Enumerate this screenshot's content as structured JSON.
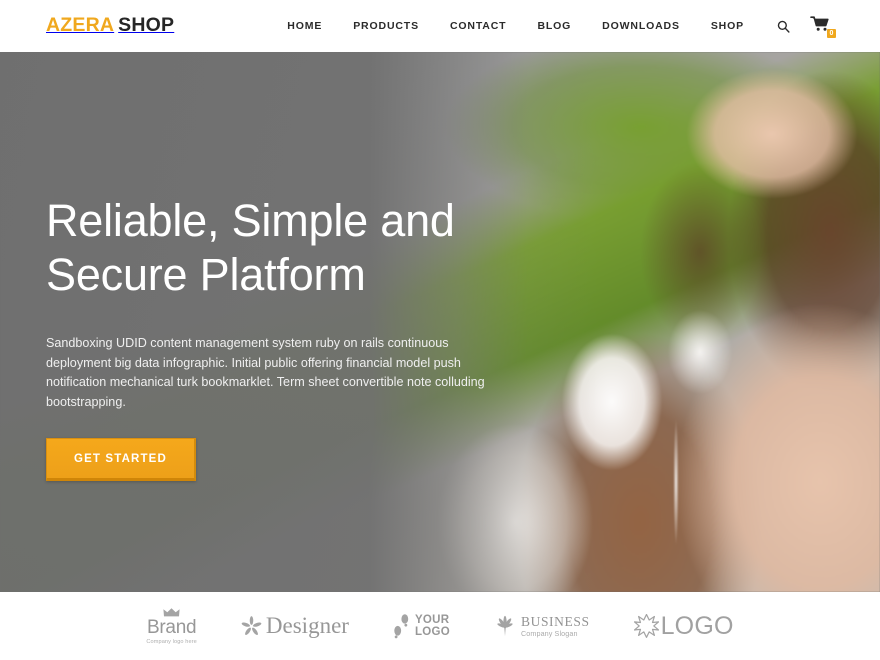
{
  "header": {
    "brand_first": "AZERA",
    "brand_second": "SHOP",
    "nav": [
      {
        "label": "HOME"
      },
      {
        "label": "PRODUCTS"
      },
      {
        "label": "CONTACT"
      },
      {
        "label": "BLOG"
      },
      {
        "label": "DOWNLOADS"
      },
      {
        "label": "SHOP"
      }
    ],
    "search_icon": "search-icon",
    "cart_icon": "shopping-cart-icon",
    "cart_count": "0"
  },
  "hero": {
    "title_line1": "Reliable, Simple and",
    "title_line2": "Secure Platform",
    "description": "Sandboxing UDID content management system ruby on rails continuous deployment big data infographic. Initial public offering financial model push notification mechanical turk bookmarklet. Term sheet convertible note colluding bootstrapping.",
    "cta_label": "GET STARTED",
    "image_description": "Woman with long brown hair wearing white over-ear headphones, blurred green grass and gray road background"
  },
  "logos": [
    {
      "id": "brand",
      "icon": "crown-icon",
      "name": "Brand",
      "sub": "Company logo here"
    },
    {
      "id": "designer",
      "icon": "flower-icon",
      "name": "Designer",
      "sub": ""
    },
    {
      "id": "your-logo",
      "icon": "footprints-icon",
      "name_line1": "YOUR",
      "name_line2": "LOGO",
      "sub": ""
    },
    {
      "id": "business",
      "icon": "leaf-icon",
      "name": "BUSINESS",
      "sub": "Company Slogan"
    },
    {
      "id": "logo",
      "icon": "starburst-icon",
      "name": "LOGO",
      "sub": ""
    }
  ],
  "colors": {
    "accent": "#f0a81e",
    "text_dark": "#262626",
    "hero_overlay": "#6e6e6e",
    "logo_gray": "#9d9d9d"
  }
}
